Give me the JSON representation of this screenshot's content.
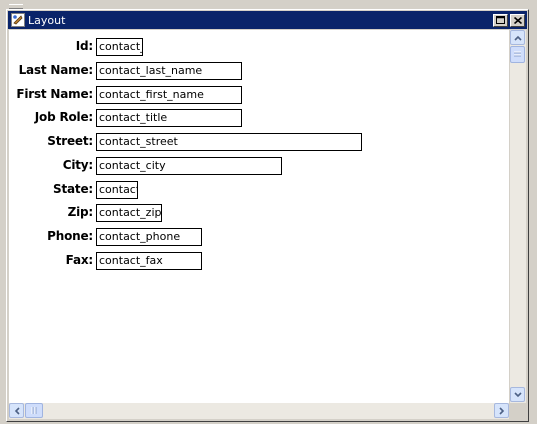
{
  "window": {
    "title": "Layout"
  },
  "icons": {
    "app": "layout-app-icon",
    "maximize": "maximize-icon",
    "close": "close-icon",
    "scroll_up": "chevron-up-icon",
    "scroll_down": "chevron-down-icon",
    "scroll_left": "chevron-left-icon",
    "scroll_right": "chevron-right-icon"
  },
  "colors": {
    "titlebar": "#0a246a",
    "window_frame": "#d4d0c8",
    "canvas": "#ffffff",
    "scrollbar_button": "#d6e4fb"
  },
  "form": {
    "fields": [
      {
        "label": "Id:",
        "value": "contact_i"
      },
      {
        "label": "Last Name:",
        "value": "contact_last_name"
      },
      {
        "label": "First Name:",
        "value": "contact_first_name"
      },
      {
        "label": "Job Role:",
        "value": "contact_title"
      },
      {
        "label": "Street:",
        "value": "contact_street"
      },
      {
        "label": "City:",
        "value": "contact_city"
      },
      {
        "label": "State:",
        "value": "contact_"
      },
      {
        "label": "Zip:",
        "value": "contact_zip"
      },
      {
        "label": "Phone:",
        "value": "contact_phone"
      },
      {
        "label": "Fax:",
        "value": "contact_fax"
      }
    ]
  }
}
